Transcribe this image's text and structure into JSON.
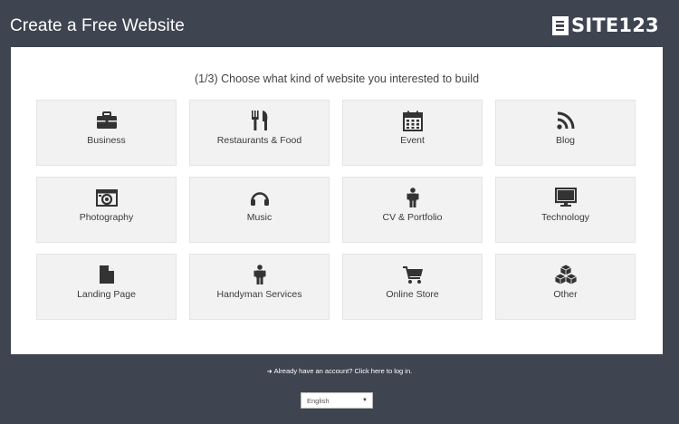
{
  "header": {
    "title": "Create a Free Website",
    "logo_text": "SITE123"
  },
  "panel": {
    "title": "(1/3) Choose what kind of website you interested to build",
    "categories": [
      {
        "label": "Business",
        "icon": "briefcase-icon"
      },
      {
        "label": "Restaurants & Food",
        "icon": "fork-knife-icon"
      },
      {
        "label": "Event",
        "icon": "calendar-icon"
      },
      {
        "label": "Blog",
        "icon": "rss-icon"
      },
      {
        "label": "Photography",
        "icon": "camera-icon"
      },
      {
        "label": "Music",
        "icon": "headphones-icon"
      },
      {
        "label": "CV & Portfolio",
        "icon": "person-icon"
      },
      {
        "label": "Technology",
        "icon": "monitor-icon"
      },
      {
        "label": "Landing Page",
        "icon": "document-icon"
      },
      {
        "label": "Handyman Services",
        "icon": "worker-icon"
      },
      {
        "label": "Online Store",
        "icon": "shopping-cart-icon"
      },
      {
        "label": "Other",
        "icon": "cubes-icon"
      }
    ]
  },
  "footer": {
    "login_text": "Already have an account? Click here to log in.",
    "language": "English"
  },
  "colors": {
    "background": "#3f4451",
    "panel": "#ffffff",
    "card": "#f2f2f2",
    "icon": "#333333"
  }
}
